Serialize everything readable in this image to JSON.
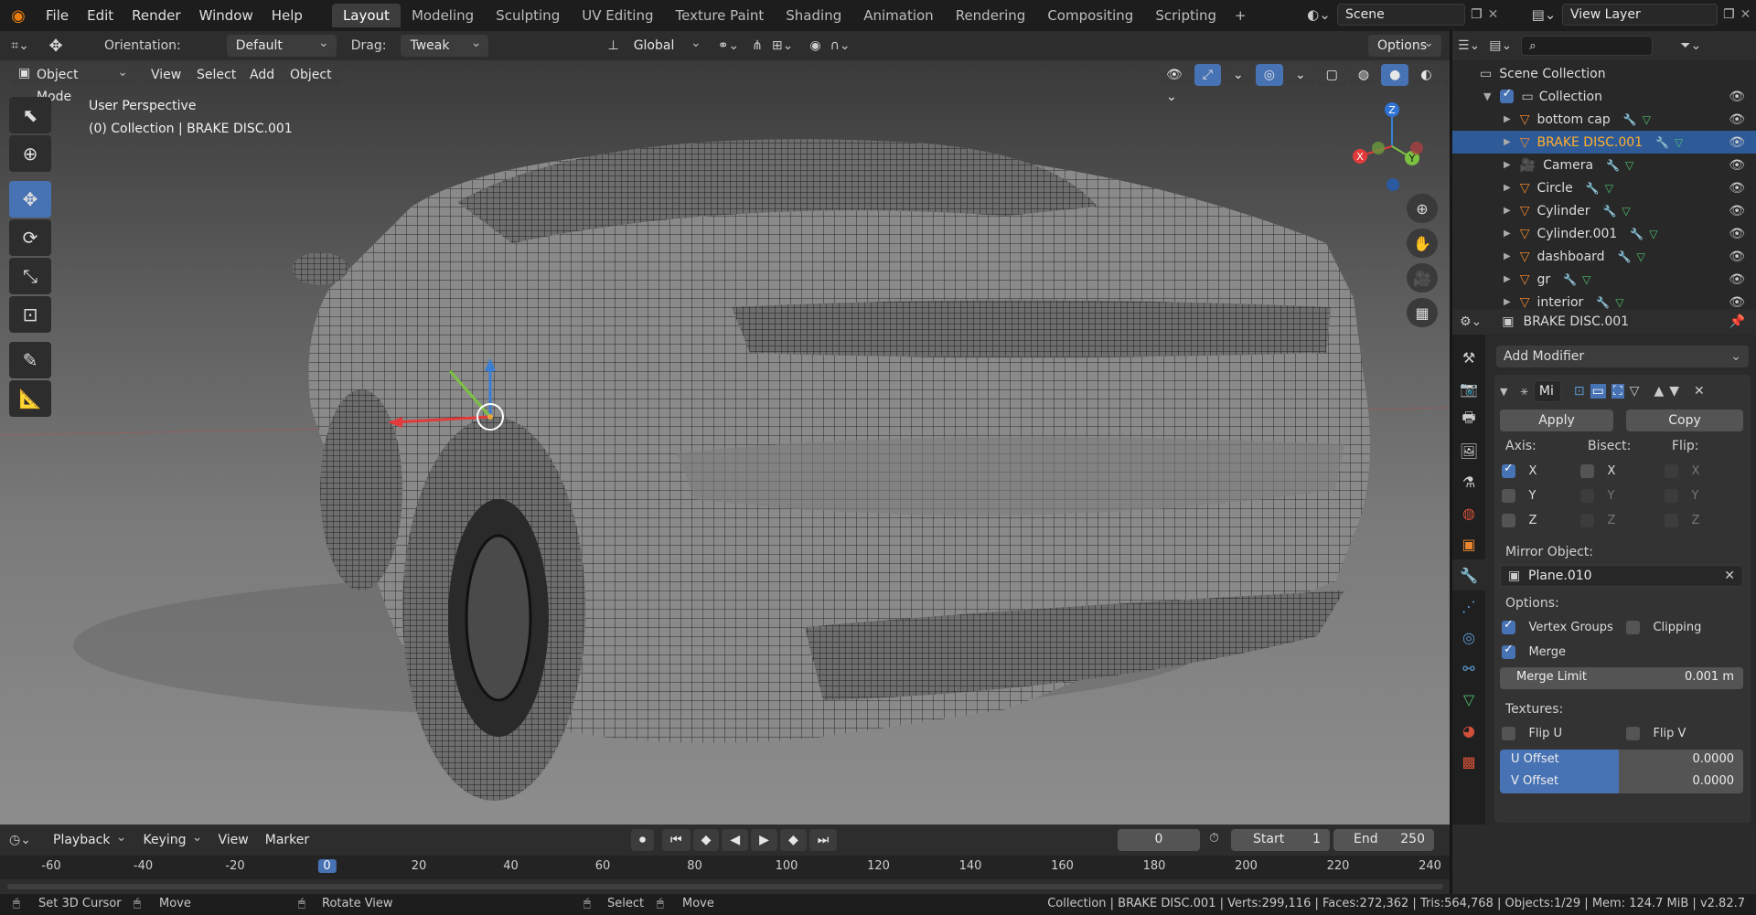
{
  "app": {
    "logo": "blender-icon"
  },
  "menu": [
    "File",
    "Edit",
    "Render",
    "Window",
    "Help"
  ],
  "workspaces": [
    "Layout",
    "Modeling",
    "Sculpting",
    "UV Editing",
    "Texture Paint",
    "Shading",
    "Animation",
    "Rendering",
    "Compositing",
    "Scripting"
  ],
  "active_workspace": "Layout",
  "scene": {
    "label": "Scene",
    "view_layer": "View Layer"
  },
  "header": {
    "orientation_label": "Orientation:",
    "orientation_value": "Default",
    "drag_label": "Drag:",
    "drag_value": "Tweak",
    "transform_space": "Global",
    "options": "Options"
  },
  "viewport": {
    "mode": "Object Mode",
    "menus": [
      "View",
      "Select",
      "Add",
      "Object"
    ],
    "overlay_line1": "User Perspective",
    "overlay_line2": "(0) Collection | BRAKE DISC.001",
    "gizmo": {
      "x": "X",
      "y": "Y",
      "z": "Z"
    }
  },
  "outliner": {
    "root": "Scene Collection",
    "collection": "Collection",
    "items": [
      {
        "name": "bottom cap"
      },
      {
        "name": "BRAKE DISC.001"
      },
      {
        "name": "Camera"
      },
      {
        "name": "Circle"
      },
      {
        "name": "Cylinder"
      },
      {
        "name": "Cylinder.001"
      },
      {
        "name": "dashboard"
      },
      {
        "name": "gr"
      },
      {
        "name": "interior"
      }
    ],
    "selected": "BRAKE DISC.001"
  },
  "properties": {
    "object_name": "BRAKE DISC.001",
    "add_modifier": "Add Modifier",
    "modifier_name": "Mi",
    "apply": "Apply",
    "copy": "Copy",
    "axis_label": "Axis:",
    "bisect_label": "Bisect:",
    "flip_label": "Flip:",
    "axes": [
      "X",
      "Y",
      "Z"
    ],
    "mirror_object_label": "Mirror Object:",
    "mirror_object": "Plane.010",
    "options_label": "Options:",
    "vertex_groups": "Vertex Groups",
    "clipping": "Clipping",
    "merge": "Merge",
    "merge_limit_label": "Merge Limit",
    "merge_limit_value": "0.001 m",
    "textures_label": "Textures:",
    "flip_u": "Flip U",
    "flip_v": "Flip V",
    "u_offset_label": "U Offset",
    "u_offset_value": "0.0000",
    "v_offset_label": "V Offset",
    "v_offset_value": "0.0000"
  },
  "timeline": {
    "menus": [
      "Playback",
      "Keying",
      "View",
      "Marker"
    ],
    "current_frame": "0",
    "start_label": "Start",
    "start_value": "1",
    "end_label": "End",
    "end_value": "250",
    "ruler": [
      "-60",
      "-40",
      "-20",
      "0",
      "20",
      "40",
      "60",
      "80",
      "100",
      "120",
      "140",
      "160",
      "180",
      "200",
      "220",
      "240"
    ]
  },
  "status": {
    "left": [
      "Set 3D Cursor",
      "Move",
      "Rotate View",
      "Select",
      "Move"
    ],
    "right": "Collection | BRAKE DISC.001 | Verts:299,116 | Faces:272,362 | Tris:564,768 | Objects:1/29 | Mem: 124.7 MiB | v2.82.7"
  }
}
